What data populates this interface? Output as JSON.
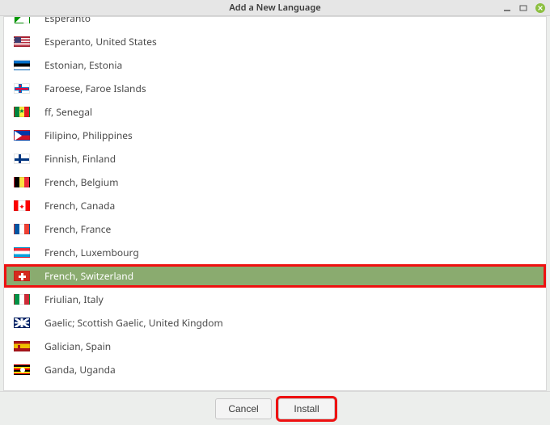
{
  "window": {
    "title": "Add a New Language"
  },
  "languages": [
    {
      "label": "Esperanto",
      "flag": "esperanto",
      "partial": "top"
    },
    {
      "label": "Esperanto, United States",
      "flag": "us"
    },
    {
      "label": "Estonian, Estonia",
      "flag": "estonia"
    },
    {
      "label": "Faroese, Faroe Islands",
      "flag": "faroe"
    },
    {
      "label": "ff, Senegal",
      "flag": "senegal"
    },
    {
      "label": "Filipino, Philippines",
      "flag": "philippines"
    },
    {
      "label": "Finnish, Finland",
      "flag": "finland"
    },
    {
      "label": "French, Belgium",
      "flag": "belgium"
    },
    {
      "label": "French, Canada",
      "flag": "canada"
    },
    {
      "label": "French, France",
      "flag": "france"
    },
    {
      "label": "French, Luxembourg",
      "flag": "luxembourg"
    },
    {
      "label": "French, Switzerland",
      "flag": "switzerland",
      "selected": true,
      "highlighted": true
    },
    {
      "label": "Friulian, Italy",
      "flag": "italy"
    },
    {
      "label": "Gaelic; Scottish Gaelic, United Kingdom",
      "flag": "uk"
    },
    {
      "label": "Galician, Spain",
      "flag": "spain"
    },
    {
      "label": "Ganda, Uganda",
      "flag": "uganda"
    }
  ],
  "buttons": {
    "cancel": "Cancel",
    "install": "Install"
  }
}
